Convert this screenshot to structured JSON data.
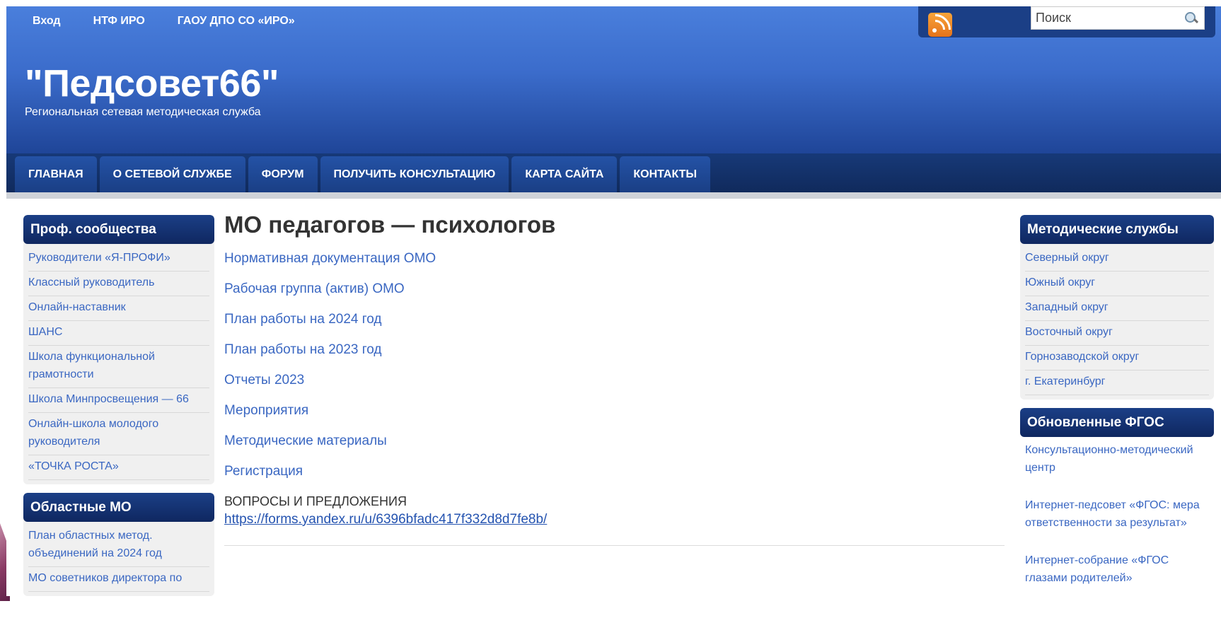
{
  "top_links": [
    "Вход",
    "НТФ ИРО",
    "ГАОУ ДПО СО «ИРО»"
  ],
  "search": {
    "placeholder": "Поиск"
  },
  "icons": {
    "rss": "rss-icon",
    "search": "magnifier-icon"
  },
  "site": {
    "title": "\"Педсовет66\"",
    "tagline": "Региональная сетевая методическая служба"
  },
  "nav": [
    "ГЛАВНАЯ",
    "О СЕТЕВОЙ СЛУЖБЕ",
    "ФОРУМ",
    "ПОЛУЧИТЬ КОНСУЛЬТАЦИЮ",
    "КАРТА САЙТА",
    "КОНТАКТЫ"
  ],
  "left_sidebar": [
    {
      "title": "Проф. сообщества",
      "items": [
        "Руководители «Я-ПРОФИ»",
        "Классный руководитель",
        "Онлайн-наставник",
        "ШАНС",
        "Школа функциональной грамотности",
        "Школа Минпросвещения — 66",
        "Онлайн-школа молодого руководителя",
        "«ТОЧКА РОСТА»"
      ]
    },
    {
      "title": "Областные МО",
      "items": [
        "План областных метод. объединений на 2024 год",
        "МО советников директора по"
      ]
    }
  ],
  "main": {
    "title": "МО педагогов — психологов",
    "links": [
      "Нормативная документация ОМО",
      "Рабочая группа (актив) ОМО",
      "План работы на 2024 год",
      "План работы на 2023 год",
      "Отчеты 2023",
      "Мероприятия",
      "Методические материалы",
      "Регистрация"
    ],
    "questions_label": "ВОПРОСЫ И ПРЕДЛОЖЕНИЯ",
    "form_url": "https://forms.yandex.ru/u/6396bfadc417f332d8d7fe8b/"
  },
  "right_sidebar": [
    {
      "title": "Методические службы",
      "items": [
        "Северный округ",
        "Южный округ",
        "Западный округ",
        "Восточный округ",
        "Горнозаводской округ",
        "г. Екатеринбург"
      ]
    },
    {
      "title": "Обновленные ФГОС",
      "items": [
        "Консультационно-методический центр",
        "Интернет-педсовет «ФГОС: мера ответственности за результат»",
        "Интернет-собрание «ФГОС глазами родителей»"
      ]
    }
  ]
}
